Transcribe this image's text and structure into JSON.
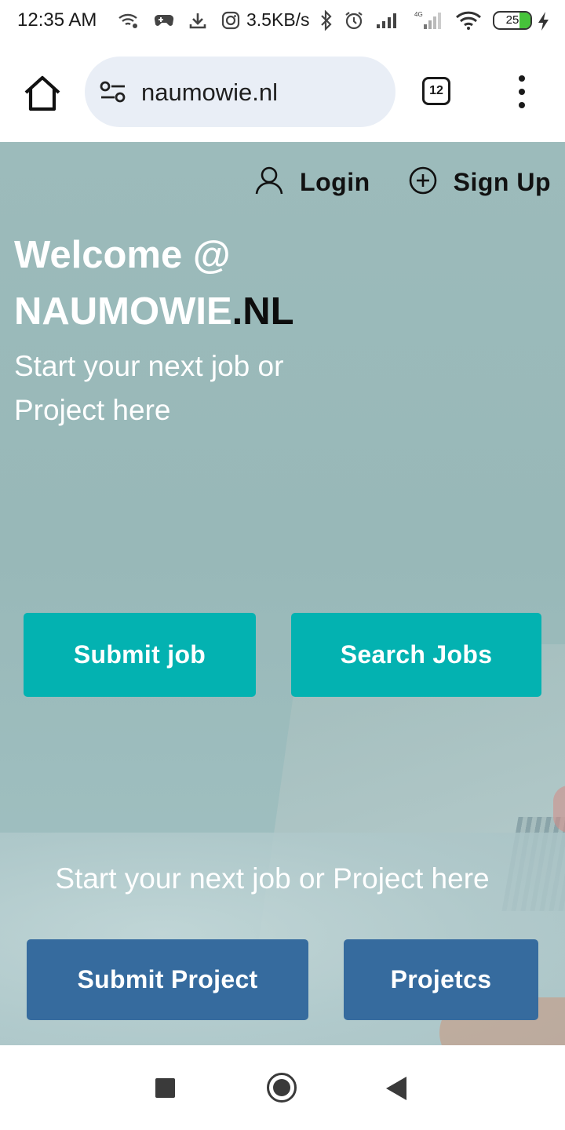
{
  "status_bar": {
    "time": "12:35 AM",
    "network_speed": "3.5KB/s",
    "battery_level": "25",
    "icons": [
      "wifi-calling-icon",
      "gamepad-icon",
      "download-icon",
      "instagram-icon",
      "bluetooth-icon",
      "alarm-icon",
      "signal-icon",
      "signal-4g-icon",
      "wifi-icon",
      "battery-icon",
      "charging-icon"
    ]
  },
  "browser": {
    "url": "naumowie.nl",
    "tab_count": "12",
    "icons": [
      "home-icon",
      "site-settings-icon",
      "tabs-icon",
      "more-menu-icon"
    ]
  },
  "page": {
    "auth": {
      "login_label": "Login",
      "signup_label": "Sign Up"
    },
    "hero": {
      "title_line1": "Welcome @",
      "title_brand": "NAUMOWIE",
      "title_suffix": ".NL",
      "subtitle": "Start your next job or Project here"
    },
    "buttons": {
      "submit_job": "Submit job",
      "search_jobs": "Search Jobs",
      "submit_project": "Submit Project",
      "projects": "Projetcs"
    },
    "tagline": "Start your next job or Project here",
    "colors": {
      "teal_button": "#03b2b1",
      "blue_button": "#366b9e",
      "hero_overlay": "#9cbbbb"
    }
  },
  "system_nav": {
    "icons": [
      "recents-icon",
      "home-circle-icon",
      "back-icon"
    ]
  }
}
